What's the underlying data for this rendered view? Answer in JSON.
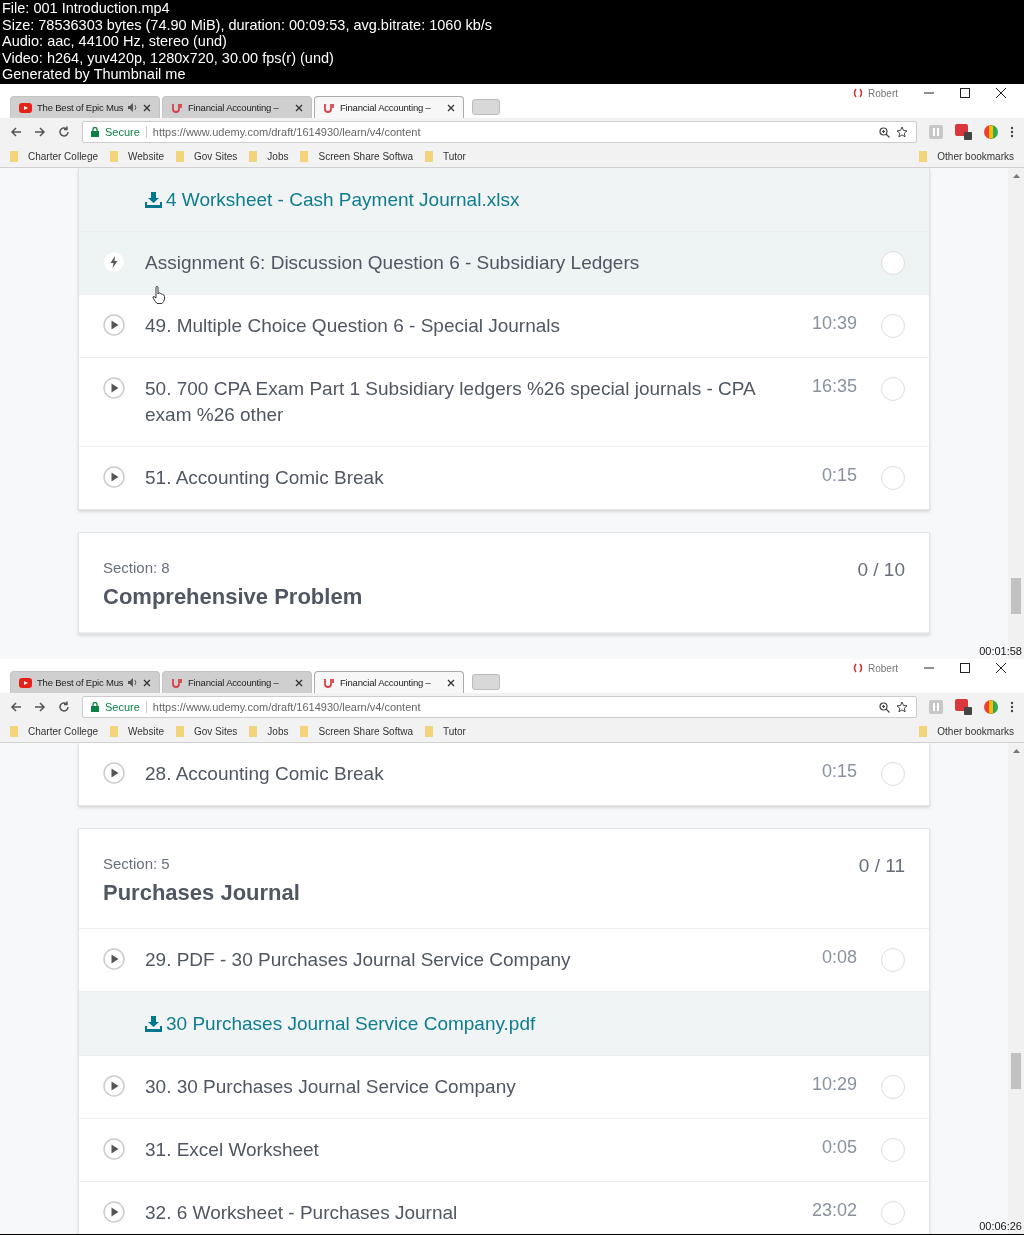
{
  "info_lines": [
    "File: 001 Introduction.mp4",
    "Size: 78536303 bytes (74.90 MiB), duration: 00:09:53, avg.bitrate: 1060 kb/s",
    "Audio: aac, 44100 Hz, stereo (und)",
    "Video: h264, yuv420p, 1280x720, 30.00 fps(r) (und)",
    "Generated by Thumbnail me"
  ],
  "frames": [
    {
      "timestamp": "00:01:58",
      "browser": {
        "profile": "Robert",
        "tabs": [
          {
            "kind": "youtube",
            "title": "The Best of Epic Mus",
            "audio": true,
            "selected": false
          },
          {
            "kind": "udemy",
            "title": "Financial Accounting –",
            "audio": false,
            "selected": false
          },
          {
            "kind": "udemy",
            "title": "Financial Accounting –",
            "audio": false,
            "selected": true
          }
        ],
        "secure_label": "Secure",
        "url": "https://www.udemy.com/draft/1614930/learn/v4/content",
        "bookmarks": [
          "Charter College",
          "Website",
          "Gov Sites",
          "Jobs",
          "Screen Share Softwa",
          "Tutor"
        ],
        "other_bookmarks": "Other bookmarks"
      },
      "cards": [
        {
          "rows": [
            {
              "kind": "download",
              "title": "4 Worksheet - Cash Payment Journal.xlsx",
              "highlighted": true
            },
            {
              "kind": "assignment",
              "title": "Assignment 6:  Discussion Question 6 - Subsidiary Ledgers",
              "highlighted": true,
              "completed": false
            },
            {
              "kind": "lecture",
              "title": "49.  Multiple Choice Question 6 - Special Journals",
              "duration": "10:39",
              "highlighted": false,
              "completed": false
            },
            {
              "kind": "lecture",
              "title": "50.  700 CPA Exam Part 1 Subsidiary ledgers %26 special journals - CPA exam %26 other",
              "duration": "16:35",
              "highlighted": false,
              "completed": false
            },
            {
              "kind": "lecture",
              "title": "51.  Accounting Comic Break",
              "duration": "0:15",
              "highlighted": false,
              "completed": false
            }
          ]
        },
        {
          "section": {
            "label": "Section: 8",
            "title": "Comprehensive Problem",
            "progress": "0 / 10"
          }
        }
      ]
    },
    {
      "timestamp": "00:06:26",
      "browser": {
        "profile": "Robert",
        "tabs": [
          {
            "kind": "youtube",
            "title": "The Best of Epic Mus",
            "audio": true,
            "selected": false
          },
          {
            "kind": "udemy",
            "title": "Financial Accounting –",
            "audio": false,
            "selected": false
          },
          {
            "kind": "udemy",
            "title": "Financial Accounting –",
            "audio": false,
            "selected": true
          }
        ],
        "secure_label": "Secure",
        "url": "https://www.udemy.com/draft/1614930/learn/v4/content",
        "bookmarks": [
          "Charter College",
          "Website",
          "Gov Sites",
          "Jobs",
          "Screen Share Softwa",
          "Tutor"
        ],
        "other_bookmarks": "Other bookmarks"
      },
      "cards": [
        {
          "rows": [
            {
              "kind": "lecture",
              "title": "28.  Accounting Comic Break",
              "duration": "0:15",
              "highlighted": false,
              "completed": false
            }
          ]
        },
        {
          "section": {
            "label": "Section: 5",
            "title": "Purchases Journal",
            "progress": "0 / 11"
          },
          "rows": [
            {
              "kind": "lecture",
              "title": "29.  PDF - 30 Purchases Journal Service Company",
              "duration": "0:08",
              "highlighted": false,
              "completed": false
            },
            {
              "kind": "download",
              "title": "30 Purchases Journal Service Company.pdf",
              "highlighted": true
            },
            {
              "kind": "lecture",
              "title": "30.  30 Purchases Journal Service Company",
              "duration": "10:29",
              "highlighted": false,
              "completed": false
            },
            {
              "kind": "lecture",
              "title": "31.  Excel Worksheet",
              "duration": "0:05",
              "highlighted": false,
              "completed": false
            },
            {
              "kind": "lecture",
              "title": "32.  6 Worksheet - Purchases Journal",
              "duration": "23:02",
              "highlighted": false,
              "completed": false
            }
          ]
        }
      ]
    }
  ]
}
